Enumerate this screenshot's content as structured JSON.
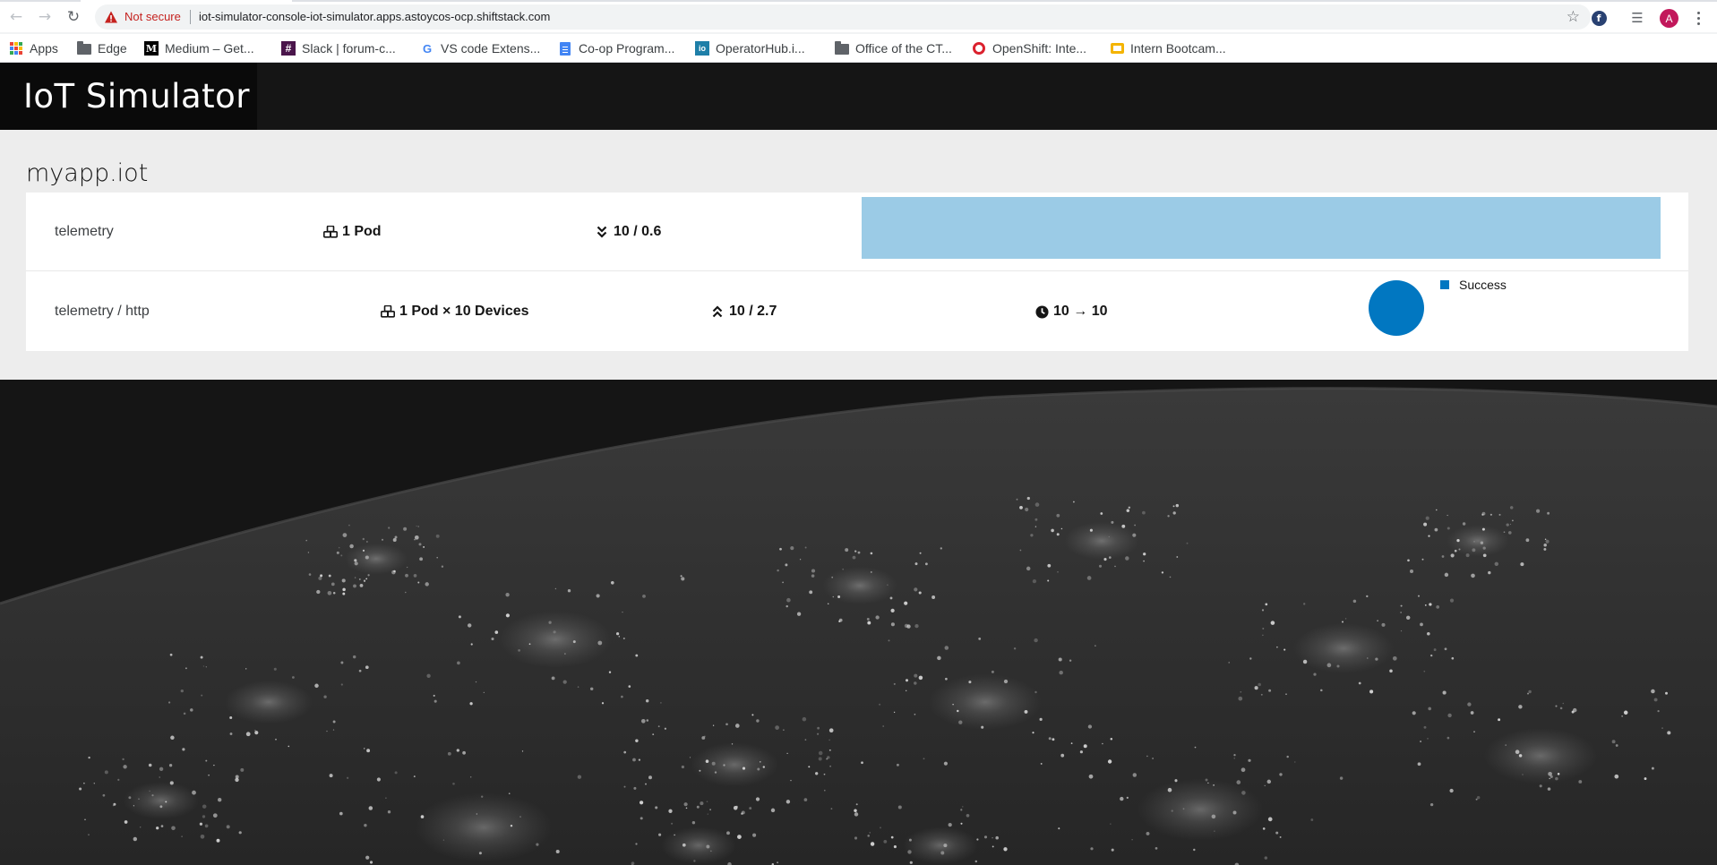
{
  "browser": {
    "security_label": "Not secure",
    "url": "iot-simulator-console-iot-simulator.apps.astoycos-ocp.shiftstack.com",
    "profile_initial": "A",
    "bookmarks": [
      {
        "label": "Apps",
        "icon": "apps-grid-icon"
      },
      {
        "label": "Edge",
        "icon": "folder-icon"
      },
      {
        "label": "Medium – Get...",
        "icon": "medium-icon"
      },
      {
        "label": "Slack | forum-c...",
        "icon": "slack-icon"
      },
      {
        "label": "VS code Extens...",
        "icon": "google-icon"
      },
      {
        "label": "Co-op Program...",
        "icon": "docs-icon"
      },
      {
        "label": "OperatorHub.i...",
        "icon": "operatorhub-icon"
      },
      {
        "label": "Office of the CT...",
        "icon": "folder-icon"
      },
      {
        "label": "OpenShift: Inte...",
        "icon": "openshift-icon"
      },
      {
        "label": "Intern Bootcam...",
        "icon": "slides-icon"
      }
    ]
  },
  "app": {
    "title": "IoT Simulator",
    "namespace": "myapp.iot",
    "consumer": {
      "name": "telemetry",
      "pods": "1 Pod",
      "rate": "10 / 0.6",
      "rate_fraction": 1.0
    },
    "producer": {
      "name": "telemetry / http",
      "pods": "1 Pod × 10 Devices",
      "rate": "10 / 2.7",
      "connections": "10 → 10",
      "legend": "Success"
    }
  },
  "colors": {
    "bar": "#9bcbe6",
    "pie_success": "#0177c1",
    "header_bg": "#151515",
    "warning": "#c5221f"
  },
  "chart_data": {
    "type": "pie",
    "categories": [
      "Success"
    ],
    "values": [
      100
    ]
  }
}
